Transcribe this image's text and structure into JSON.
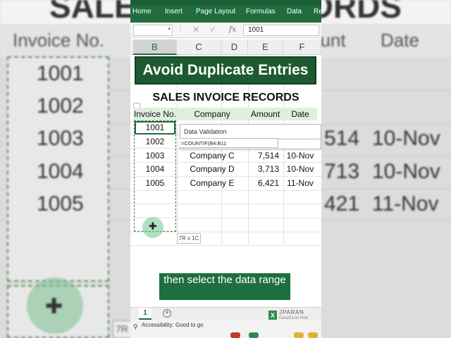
{
  "background": {
    "title_left": "SALES",
    "title_right": "RECORDS",
    "header_left": "Invoice No.",
    "header_mid": "ount",
    "header_right": "Date",
    "left_values": [
      "1001",
      "1002",
      "1003",
      "1004",
      "1005"
    ],
    "right_amounts": [
      "514",
      "713",
      "421"
    ],
    "right_dates": [
      "10-Nov",
      "10-Nov",
      "11-Nov"
    ],
    "footer_fragment": "7R"
  },
  "ribbon": {
    "tabs": [
      "Home",
      "Insert",
      "Page Layout",
      "Formulas",
      "Data",
      "Re"
    ]
  },
  "formula_bar": {
    "fx_label": "fx",
    "value": "1001"
  },
  "columns": [
    "B",
    "C",
    "D",
    "E",
    "F"
  ],
  "banner": "Avoid Duplicate Entries",
  "sheet_title": "SALES INVOICE RECORDS",
  "table": {
    "headers": {
      "invoice": "Invoice No.",
      "company": "Company",
      "amount": "Amount",
      "date": "Date"
    },
    "rows": [
      {
        "invoice": "1001",
        "company": "",
        "amount": "",
        "date": ""
      },
      {
        "invoice": "1002",
        "company": "",
        "amount": "",
        "date": ""
      },
      {
        "invoice": "1003",
        "company": "Company C",
        "amount": "7,514",
        "date": "10-Nov"
      },
      {
        "invoice": "1004",
        "company": "Company D",
        "amount": "3,713",
        "date": "10-Nov"
      },
      {
        "invoice": "1005",
        "company": "Company E",
        "amount": "6,421",
        "date": "11-Nov"
      }
    ]
  },
  "data_validation": {
    "title": "Data Validation",
    "formula": "=COUNTIF(B4:B11"
  },
  "selection_tip": "7R x 1C",
  "caption": "then select the data range",
  "sheet_tab": "1",
  "status": "Accessibility: Good to go",
  "watermark": {
    "name": "JPARAN",
    "sub": "EasyExcel·Hub"
  },
  "colors": {
    "excel_green": "#1f6d3e",
    "banner_green": "#1e5a31",
    "header_fill": "#dfeedd"
  }
}
